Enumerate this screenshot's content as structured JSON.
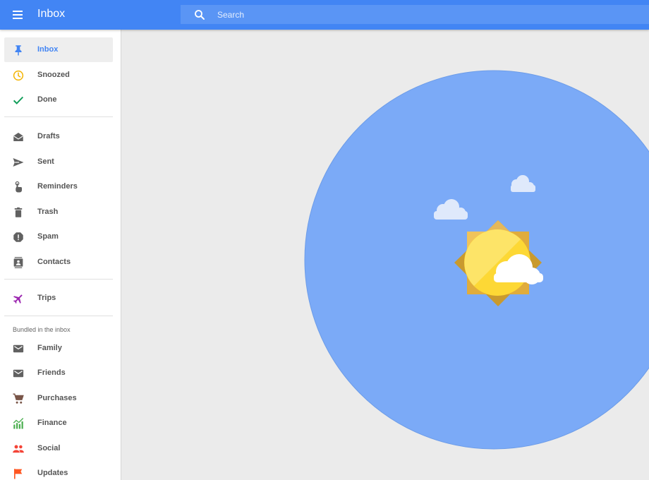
{
  "header": {
    "app_title": "Inbox",
    "menu_icon": "hamburger-menu-icon",
    "search": {
      "placeholder": "Search",
      "value": "",
      "icon": "search-icon"
    },
    "colors": {
      "bar": "#4285f4",
      "search_bg": "#5a95f5"
    }
  },
  "sidebar": {
    "primary": [
      {
        "label": "Inbox",
        "icon": "pin-icon",
        "active": true,
        "color": "#4285f4"
      },
      {
        "label": "Snoozed",
        "icon": "clock-icon",
        "color": "#f4b400"
      },
      {
        "label": "Done",
        "icon": "checkmark-icon",
        "color": "#0f9d58"
      }
    ],
    "secondary": [
      {
        "label": "Drafts",
        "icon": "drafts-icon"
      },
      {
        "label": "Sent",
        "icon": "send-icon"
      },
      {
        "label": "Reminders",
        "icon": "reminder-hand-icon"
      },
      {
        "label": "Trash",
        "icon": "trash-icon"
      },
      {
        "label": "Spam",
        "icon": "spam-icon"
      },
      {
        "label": "Contacts",
        "icon": "contacts-icon"
      }
    ],
    "trips": {
      "label": "Trips",
      "icon": "airplane-icon",
      "color": "#9c27b0"
    },
    "bundles_header": "Bundled in the inbox",
    "bundles": [
      {
        "label": "Family",
        "icon": "mail-icon"
      },
      {
        "label": "Friends",
        "icon": "mail-icon"
      },
      {
        "label": "Purchases",
        "icon": "cart-icon",
        "color": "#795548"
      },
      {
        "label": "Finance",
        "icon": "finance-chart-icon",
        "color": "#4caf50"
      },
      {
        "label": "Social",
        "icon": "people-icon",
        "color": "#f44336"
      },
      {
        "label": "Updates",
        "icon": "flag-icon",
        "color": "#ff5722"
      }
    ]
  },
  "main": {
    "illustration": "sun-and-clouds-illustration",
    "colors": {
      "circle": "#7baaf7",
      "sun": "#fdd835",
      "background": "#ebebeb"
    }
  }
}
